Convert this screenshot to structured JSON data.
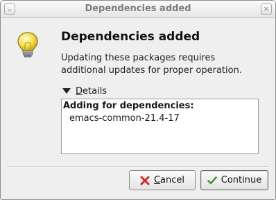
{
  "window": {
    "title": "Dependencies added",
    "menu_glyph": "⌄",
    "close_glyph": "×"
  },
  "dialog": {
    "icon": "lightbulb-icon",
    "heading": "Dependencies added",
    "message": "Updating these packages requires additional updates for proper operation.",
    "details_label": "Details",
    "details_header": "Adding for dependencies:",
    "details_items": [
      "emacs-common-21.4-17"
    ]
  },
  "buttons": {
    "cancel_label": "Cancel",
    "continue_label": "Continue"
  },
  "colors": {
    "cancel_icon": "#d42a2a",
    "continue_icon": "#3a9a2a",
    "bulb": "#f5e04a"
  }
}
